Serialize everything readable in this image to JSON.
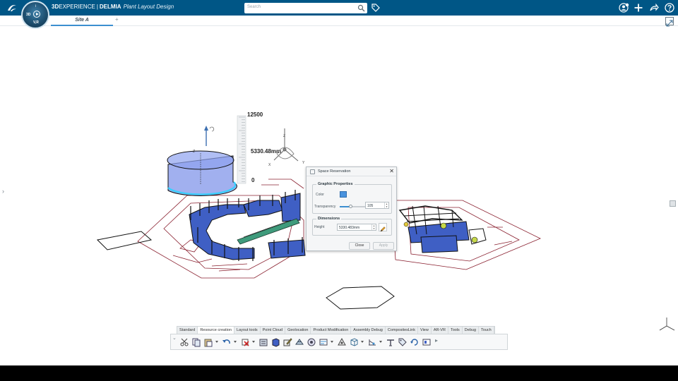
{
  "app": {
    "brand_bold": "3D",
    "brand_rest": "EXPERIENCE",
    "separator": "|",
    "product": "DELMIA",
    "app_name": "Plant Layout Design",
    "ds_logo": "3S"
  },
  "compass": {
    "label_3d": "3D",
    "label_vr": "V,R",
    "label_info": "i"
  },
  "search": {
    "placeholder": "Search"
  },
  "tabs": {
    "active": "Site A",
    "add": "+"
  },
  "scene": {
    "ruler_max": "12500",
    "ruler_value": "5330.48mm",
    "ruler_min": "0",
    "axis_z": "Z",
    "axis_x": "X",
    "axis_y": "Y",
    "reservation_z": "Z"
  },
  "dialog": {
    "title": "Space Reservation",
    "close_glyph": "✕",
    "graphic_group": "Graphic Properties",
    "color_label": "Color",
    "color_value": "#4a93de",
    "transparency_label": "Transparency",
    "transparency_value": "105",
    "dimensions_group": "Dimensions",
    "height_label": "Height",
    "height_value": "5330.483mm",
    "close_button": "Close",
    "apply_button": "Apply"
  },
  "action_bar": {
    "tabs": [
      "Standard",
      "Resource creation",
      "Layout tools",
      "Point Cloud",
      "Geolocation",
      "Product Modification",
      "Assembly Debug",
      "CompositesLink",
      "View",
      "AR-VR",
      "Tools",
      "Debug",
      "Touch"
    ],
    "active_tab": "Resource creation",
    "tools": [
      "cut-icon",
      "copy-icon",
      "paste-icon",
      "undo-icon",
      "delete-icon",
      "insert-icon",
      "block-icon",
      "edit-icon",
      "mesh-icon",
      "robot-icon",
      "planner-icon",
      "workcell-icon",
      "cube-icon",
      "measure-icon",
      "sensor-icon",
      "tag-icon",
      "refresh-icon",
      "layout-icon"
    ]
  },
  "colors": {
    "topbar": "#005686",
    "accent": "#3c8fd0",
    "reservation_fill": "#6f86e6",
    "reservation_edge": "#36d0ff",
    "fence": "#3f5fc4",
    "floor_lines": "#8a2130"
  }
}
